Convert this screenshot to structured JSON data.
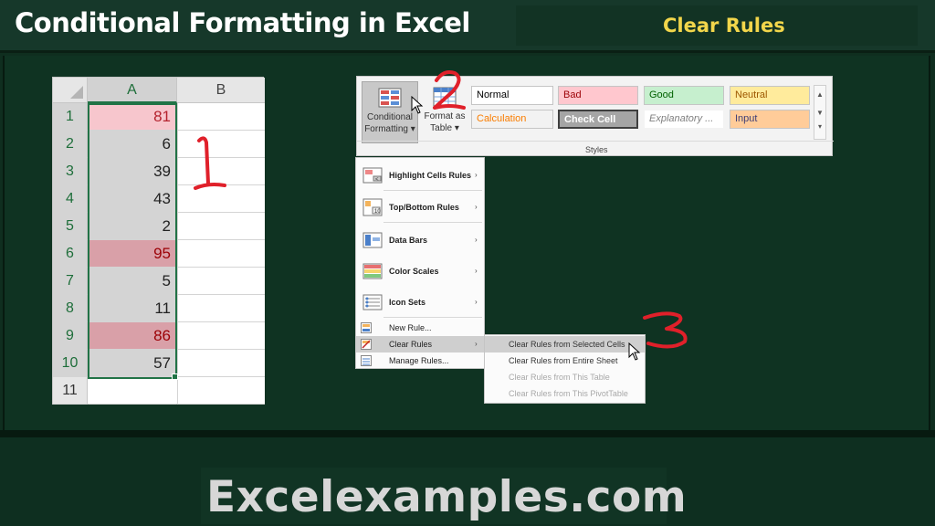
{
  "header": {
    "title": "Conditional Formatting in Excel",
    "subtitle": "Clear Rules"
  },
  "footer": {
    "site": "Excelexamples.com"
  },
  "spreadsheet": {
    "columns": [
      "A",
      "B"
    ],
    "rows": [
      {
        "row": "1",
        "value": "81",
        "format": "red-light"
      },
      {
        "row": "2",
        "value": "6",
        "format": "grey"
      },
      {
        "row": "3",
        "value": "39",
        "format": "grey"
      },
      {
        "row": "4",
        "value": "43",
        "format": "grey"
      },
      {
        "row": "5",
        "value": "2",
        "format": "grey"
      },
      {
        "row": "6",
        "value": "95",
        "format": "red-dark"
      },
      {
        "row": "7",
        "value": "5",
        "format": "grey"
      },
      {
        "row": "8",
        "value": "11",
        "format": "grey"
      },
      {
        "row": "9",
        "value": "86",
        "format": "red-dark"
      },
      {
        "row": "10",
        "value": "57",
        "format": "grey"
      },
      {
        "row": "11",
        "value": "",
        "format": "empty"
      }
    ],
    "selected_range": "A1:A10"
  },
  "ribbon": {
    "conditional_formatting": {
      "line1": "Conditional",
      "line2": "Formatting"
    },
    "format_as_table": {
      "line1": "Format as",
      "line2": "Table"
    },
    "group_label": "Styles",
    "styles": [
      {
        "label": "Normal",
        "bg": "#ffffff",
        "fg": "#000000"
      },
      {
        "label": "Bad",
        "bg": "#ffc7ce",
        "fg": "#9c0006"
      },
      {
        "label": "Good",
        "bg": "#c6efce",
        "fg": "#006100"
      },
      {
        "label": "Neutral",
        "bg": "#ffeb9c",
        "fg": "#9c5700"
      },
      {
        "label": "Calculation",
        "bg": "#f2f2f2",
        "fg": "#fa7d00"
      },
      {
        "label": "Check Cell",
        "bg": "#a5a5a5",
        "fg": "#ffffff"
      },
      {
        "label": "Explanatory ...",
        "bg": "#ffffff",
        "fg": "#7f7f7f"
      },
      {
        "label": "Input",
        "bg": "#ffcc99",
        "fg": "#3f3f76"
      }
    ]
  },
  "menu": {
    "items": [
      {
        "label": "Highlight Cells Rules",
        "icon": "highlight-cells-icon",
        "submenu": true
      },
      {
        "label": "Top/Bottom Rules",
        "icon": "top-bottom-icon",
        "submenu": true
      },
      {
        "label": "Data Bars",
        "icon": "data-bars-icon",
        "submenu": true
      },
      {
        "label": "Color Scales",
        "icon": "color-scales-icon",
        "submenu": true
      },
      {
        "label": "Icon Sets",
        "icon": "icon-sets-icon",
        "submenu": true
      },
      {
        "label": "New Rule...",
        "icon": "new-rule-icon",
        "submenu": false
      },
      {
        "label": "Clear Rules",
        "icon": "clear-rules-icon",
        "submenu": true
      },
      {
        "label": "Manage Rules...",
        "icon": "manage-rules-icon",
        "submenu": false
      }
    ],
    "submenu_arrow": "›"
  },
  "clear_submenu": {
    "items": [
      {
        "label": "Clear Rules from Selected Cells",
        "enabled": true
      },
      {
        "label": "Clear Rules from Entire Sheet",
        "enabled": true
      },
      {
        "label": "Clear Rules from This Table",
        "enabled": false
      },
      {
        "label": "Clear Rules from This PivotTable",
        "enabled": false
      }
    ]
  },
  "annotations": {
    "step1": "1",
    "step2": "2",
    "step3": "3",
    "color": "#e0202a"
  },
  "colors": {
    "background": "#0f2e1f",
    "header_accent": "#f2d64b",
    "excel_green": "#217346"
  }
}
